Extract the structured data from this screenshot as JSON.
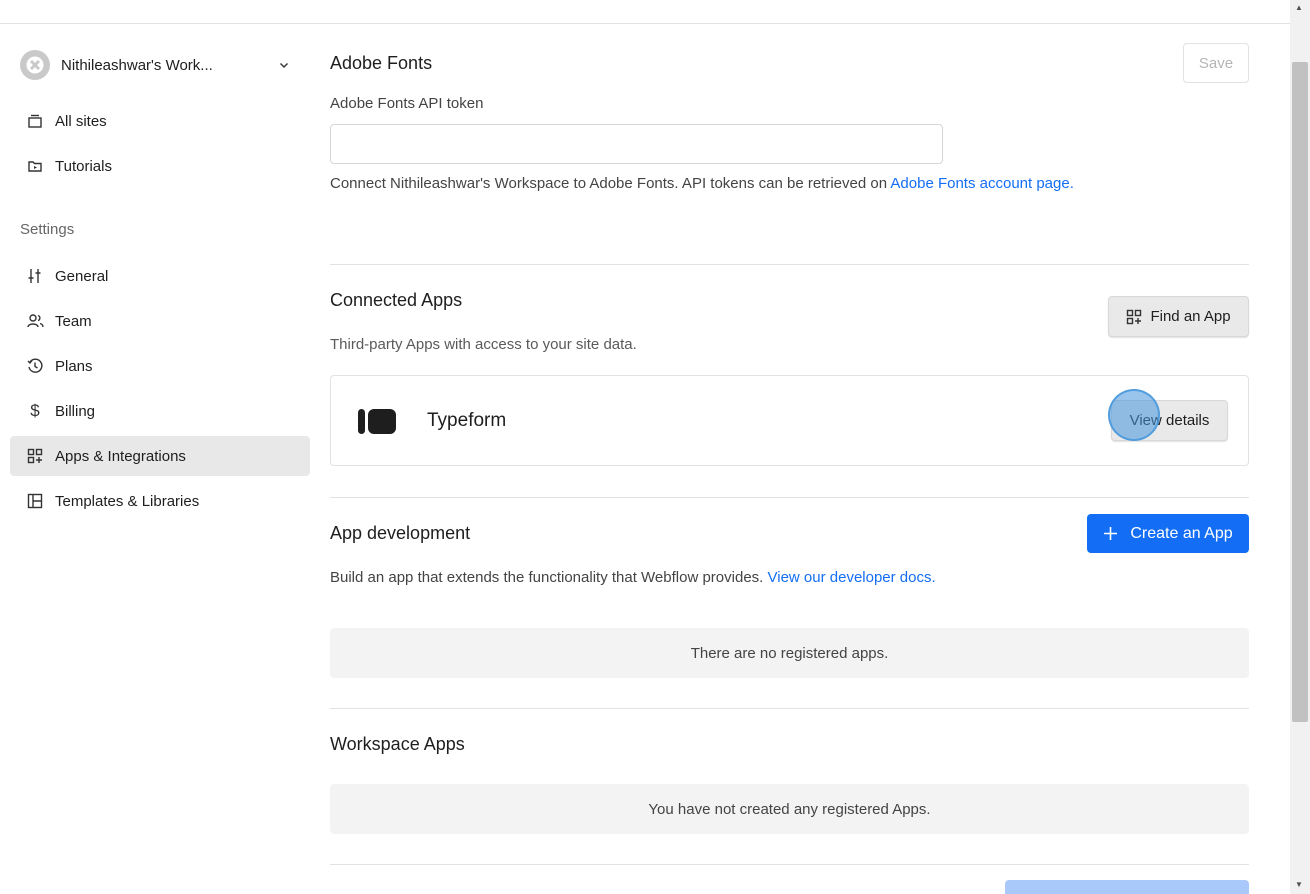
{
  "sidebar": {
    "workspace_name": "Nithileashwar's Work...",
    "nav_top": [
      {
        "label": "All sites",
        "icon": "all-sites-icon"
      },
      {
        "label": "Tutorials",
        "icon": "tutorials-icon"
      }
    ],
    "settings_label": "Settings",
    "nav_settings": [
      {
        "label": "General",
        "icon": "general-sliders-icon"
      },
      {
        "label": "Team",
        "icon": "team-icon"
      },
      {
        "label": "Plans",
        "icon": "plans-icon"
      },
      {
        "label": "Billing",
        "icon": "dollar-icon"
      },
      {
        "label": "Apps & Integrations",
        "icon": "apps-icon",
        "active": true
      },
      {
        "label": "Templates & Libraries",
        "icon": "templates-icon"
      }
    ]
  },
  "adobe_fonts": {
    "title": "Adobe Fonts",
    "save_label": "Save",
    "token_label": "Adobe Fonts API token",
    "token_value": "",
    "description": "Connect Nithileashwar's Workspace to Adobe Fonts. API tokens can be retrieved on ",
    "link_text": "Adobe Fonts account page."
  },
  "connected_apps": {
    "title": "Connected Apps",
    "subtitle": "Third-party Apps with access to your site data.",
    "find_app_label": "Find an App",
    "apps": [
      {
        "name": "Typeform",
        "action_label": "View details",
        "icon": "typeform-logo-icon"
      }
    ]
  },
  "app_development": {
    "title": "App development",
    "create_label": "Create an App",
    "description": "Build an app that extends the functionality that Webflow provides. ",
    "link_text": "View our developer docs.",
    "empty_text": "There are no registered apps."
  },
  "workspace_apps": {
    "title": "Workspace Apps",
    "empty_text": "You have not created any registered Apps."
  },
  "colors": {
    "accent": "#146ef5",
    "active_nav": "#e8e8e8"
  }
}
